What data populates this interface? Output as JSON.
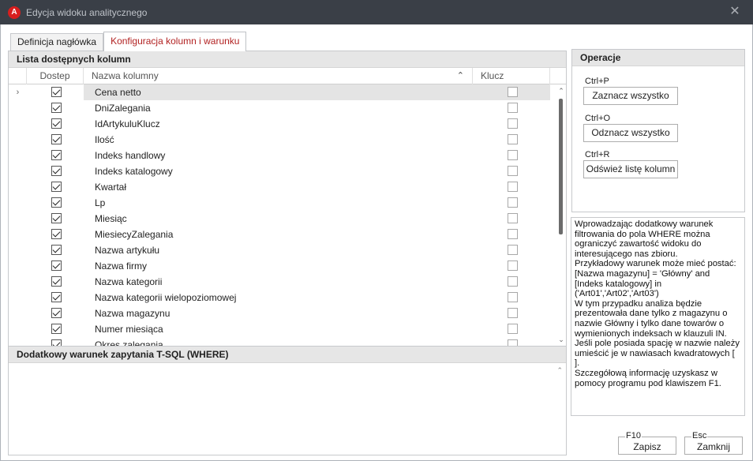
{
  "window": {
    "title": "Edycja widoku analitycznego",
    "logo_letter": "A",
    "close_glyph": "✕"
  },
  "tabs": [
    {
      "label": "Definicja nagłówka",
      "active": false
    },
    {
      "label": "Konfiguracja kolumn  i warunku",
      "active": true
    }
  ],
  "columns_group": {
    "title": "Lista dostępnych kolumn",
    "headers": {
      "dostep": "Dostep",
      "name": "Nazwa kolumny",
      "klucz": "Klucz"
    },
    "sort_glyph": "⌃",
    "rows": [
      {
        "name": "Cena netto",
        "dostep": true,
        "klucz": false,
        "selected": true
      },
      {
        "name": "DniZalegania",
        "dostep": true,
        "klucz": false
      },
      {
        "name": "IdArtykuluKlucz",
        "dostep": true,
        "klucz": false
      },
      {
        "name": "Ilość",
        "dostep": true,
        "klucz": false
      },
      {
        "name": "Indeks handlowy",
        "dostep": true,
        "klucz": false
      },
      {
        "name": "Indeks katalogowy",
        "dostep": true,
        "klucz": false
      },
      {
        "name": "Kwartał",
        "dostep": true,
        "klucz": false
      },
      {
        "name": "Lp",
        "dostep": true,
        "klucz": false
      },
      {
        "name": "Miesiąc",
        "dostep": true,
        "klucz": false
      },
      {
        "name": "MiesiecyZalegania",
        "dostep": true,
        "klucz": false
      },
      {
        "name": "Nazwa artykułu",
        "dostep": true,
        "klucz": false
      },
      {
        "name": "Nazwa firmy",
        "dostep": true,
        "klucz": false
      },
      {
        "name": "Nazwa kategorii",
        "dostep": true,
        "klucz": false
      },
      {
        "name": "Nazwa kategorii wielopoziomowej",
        "dostep": true,
        "klucz": false
      },
      {
        "name": "Nazwa magazynu",
        "dostep": true,
        "klucz": false
      },
      {
        "name": "Numer miesiąca",
        "dostep": true,
        "klucz": false
      },
      {
        "name": "Okres zalegania",
        "dostep": true,
        "klucz": false
      }
    ]
  },
  "where_group": {
    "title": "Dodatkowy warunek zapytania T-SQL (WHERE)",
    "value": ""
  },
  "operations": {
    "title": "Operacje",
    "buttons": [
      {
        "shortcut": "Ctrl+P",
        "label": "Zaznacz wszystko"
      },
      {
        "shortcut": "Ctrl+O",
        "label": "Odznacz wszystko"
      },
      {
        "shortcut": "Ctrl+R",
        "label": "Odśwież listę kolumn"
      }
    ]
  },
  "info_text": "Wprowadzając dodatkowy warunek\nfiltrowania do pola WHERE można\nograniczyć zawartość widoku do\ninteresującego nas zbioru.\nPrzykładowy warunek może mieć postać:\n[Nazwa magazynu] = 'Główny' and\n[Indeks katalogowy] in\n('Art01','Art02','Art03')\nW tym przypadku analiza będzie\nprezentowała dane tylko z magazynu o\nnazwie Główny i tylko dane towarów o\nwymienionych indeksach w klauzuli IN.\nJeśli pole posiada spację w nazwie należy\numieścić je w nawiasach kwadratowych [\n].\nSzczegółową informację uzyskasz w\npomocy programu pod klawiszem F1.",
  "footer": {
    "save": {
      "key": "F10",
      "label": "Zapisz"
    },
    "close": {
      "key": "Esc",
      "label": "Zamknij"
    }
  },
  "scroll_glyphs": {
    "up": "⌃",
    "down": "⌄",
    "row_indicator": "›"
  }
}
